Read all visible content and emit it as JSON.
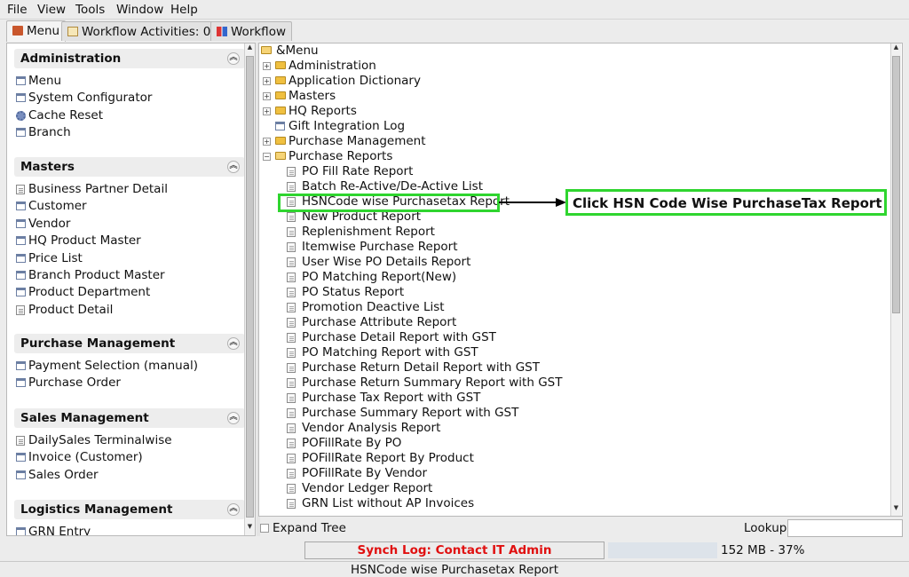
{
  "menubar": {
    "file": "File",
    "view": "View",
    "tools": "Tools",
    "window": "Window",
    "help": "Help"
  },
  "tabs": {
    "menu": "Menu",
    "workflow_activities": "Workflow Activities: 0",
    "workflow": "Workflow"
  },
  "sidebar": {
    "sections": [
      {
        "title": "Administration",
        "items": [
          "Menu",
          "System Configurator",
          "Cache Reset",
          "Branch"
        ]
      },
      {
        "title": "Masters",
        "items": [
          "Business Partner Detail",
          "Customer",
          "Vendor",
          "HQ Product Master",
          "Price List",
          "Branch Product Master",
          "Product Department",
          "Product Detail"
        ]
      },
      {
        "title": "Purchase Management",
        "items": [
          "Payment Selection (manual)",
          "Purchase Order"
        ]
      },
      {
        "title": "Sales Management",
        "items": [
          "DailySales Terminalwise",
          "Invoice (Customer)",
          "Sales Order"
        ]
      },
      {
        "title": "Logistics Management",
        "items": [
          "GRN Entry"
        ]
      }
    ]
  },
  "tree": {
    "root": "&Menu",
    "folders": [
      "Administration",
      "Application Dictionary",
      "Masters",
      "HQ Reports",
      "Gift Integration Log",
      "Purchase Management",
      "Purchase Reports"
    ],
    "reports": [
      "PO Fill Rate Report",
      "Batch Re-Active/De-Active List",
      "HSNCode wise Purchasetax Report",
      "New Product Report",
      "Replenishment Report",
      "Itemwise Purchase Report",
      "User Wise PO Details Report",
      "PO Matching Report(New)",
      "PO Status Report",
      "Promotion Deactive List",
      "Purchase Attribute Report",
      "Purchase Detail Report with GST",
      "PO Matching Report with GST",
      "Purchase Return Detail Report with GST",
      "Purchase Return Summary Report with GST",
      "Purchase Tax Report with GST",
      "Purchase Summary Report with GST",
      "Vendor Analysis Report",
      "POFillRate By PO",
      "POFillRate Report By Product",
      "POFillRate By Vendor",
      "Vendor Ledger Report",
      "GRN List without AP Invoices"
    ]
  },
  "annotation": {
    "callout": "Click HSN Code Wise PurchaseTax Report",
    "color": "#2fd52f"
  },
  "controls": {
    "expand_tree": "Expand Tree",
    "lookup": "Lookup"
  },
  "status": {
    "synch_log": "Synch Log: Contact IT Admin",
    "memory": "152 MB - 37%",
    "memory_percent": 37,
    "selected": "HSNCode wise Purchasetax Report"
  }
}
